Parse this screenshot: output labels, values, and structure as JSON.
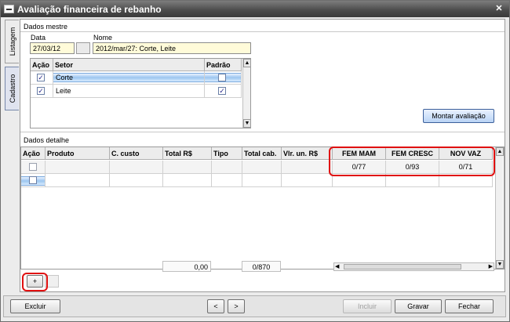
{
  "window": {
    "title": "Avaliação financeira de rebanho",
    "close_glyph": "✕"
  },
  "side_tabs": [
    {
      "label": "Listagem"
    },
    {
      "label": "Cadastro"
    }
  ],
  "master": {
    "section_label": "Dados mestre",
    "data_label": "Data",
    "data_value": "27/03/12",
    "nome_label": "Nome",
    "nome_value": "2012/mar/27: Corte, Leite",
    "columns": [
      "Ação",
      "Setor",
      "Padrão"
    ],
    "rows": [
      {
        "acao": true,
        "setor": "Corte",
        "padrao": false,
        "selected": true
      },
      {
        "acao": true,
        "setor": "Leite",
        "padrao": true,
        "selected": false
      }
    ],
    "montar_button": "Montar avaliação"
  },
  "detail": {
    "section_label": "Dados detalhe",
    "columns": [
      "Ação",
      "Produto",
      "C. custo",
      "Total R$",
      "Tipo",
      "Total cab.",
      "Vlr. un. R$",
      "FEM MAM",
      "FEM CRESC",
      "NOV VAZ"
    ],
    "row": {
      "fem_mam": "0/77",
      "fem_cresc": "0/93",
      "nov_vaz": "0/71"
    },
    "footer": {
      "total_rs": "0,00",
      "total_cab": "0/870"
    },
    "add_button": "+"
  },
  "bottom": {
    "excluir": "Excluir",
    "prev": "<",
    "next": ">",
    "incluir": "Incluir",
    "gravar": "Gravar",
    "fechar": "Fechar"
  },
  "colors": {
    "highlight": "#e01010",
    "input_bg": "#fffbd9"
  }
}
